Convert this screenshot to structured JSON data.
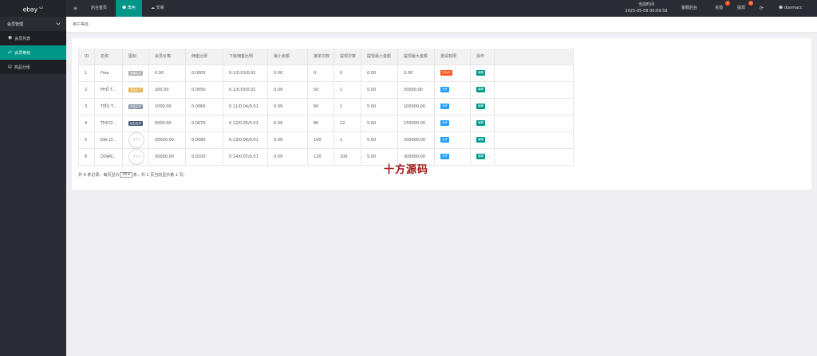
{
  "sidebar": {
    "logo": "ebay",
    "logo_sup": "V.2",
    "group_label": "会员管理",
    "items": [
      {
        "label": "会员列表",
        "icon": "user-icon"
      },
      {
        "label": "会员等级",
        "icon": "link-icon"
      },
      {
        "label": "商品分组",
        "icon": "list-icon"
      }
    ]
  },
  "topbar": {
    "menu_icon": "≡",
    "tabs": [
      {
        "label": "后台首页"
      },
      {
        "label": "角色"
      },
      {
        "label": "交易"
      }
    ],
    "time_label": "当前时间",
    "time_value": "2025-05-08 00:09:58",
    "links": [
      {
        "label": "客服后台"
      },
      {
        "label": "充值",
        "badge": "0"
      },
      {
        "label": "提现",
        "badge": "0"
      }
    ],
    "refresh_icon": "⟳",
    "username": "duomacc"
  },
  "breadcrumb": {
    "label": "用户等级"
  },
  "table": {
    "headers": [
      "ID",
      "名称",
      "图标",
      "会员价格",
      "佣金比例",
      "下级佣金比例",
      "最小余额",
      "接单次数",
      "提现次数",
      "提现最小金额",
      "提现最大金额",
      "邀请权限",
      "操作"
    ],
    "rows": [
      {
        "id": "1",
        "name": "Free",
        "icon": {
          "kind": "tag",
          "text": "普通会员",
          "color": "#b0b0b0"
        },
        "price": "0.00",
        "commission": "0.0000",
        "sub_commission": "0.1/0.03/0.01",
        "min_balance": "0.00",
        "orders": "0",
        "withdraws": "0",
        "withdraw_min": "0.00",
        "withdraw_max": "0.00",
        "invite": {
          "text": "不允许",
          "color": "red"
        },
        "action": "编辑"
      },
      {
        "id": "2",
        "name": "PHỔ T...",
        "icon": {
          "kind": "tag",
          "text": "黄金会员",
          "color": "#e8b04a"
        },
        "price": "200.00",
        "commission": "0.0050",
        "sub_commission": "0.1/0.03/0.01",
        "min_balance": "0.09",
        "orders": "50",
        "withdraws": "1",
        "withdraw_min": "5.00",
        "withdraw_max": "50000.00",
        "invite": {
          "text": "允许",
          "color": "blue"
        },
        "action": "编辑"
      },
      {
        "id": "3",
        "name": "TIỂU T...",
        "icon": {
          "kind": "tag",
          "text": "铂金会员",
          "color": "#8a94a8"
        },
        "price": "1000.00",
        "commission": "0.0060",
        "sub_commission": "0.11/0.04/0.01",
        "min_balance": "0.09",
        "orders": "60",
        "withdraws": "1",
        "withdraw_min": "5.00",
        "withdraw_max": "100000.00",
        "invite": {
          "text": "允许",
          "color": "blue"
        },
        "action": "编辑"
      },
      {
        "id": "4",
        "name": "THƯỢ...",
        "icon": {
          "kind": "tag",
          "text": "钻石会员",
          "color": "#4a5a78"
        },
        "price": "5000.00",
        "commission": "0.0070",
        "sub_commission": "0.12/0.05/0.01",
        "min_balance": "0.09",
        "orders": "80",
        "withdraws": "12",
        "withdraw_min": "5.00",
        "withdraw_max": "150000.00",
        "invite": {
          "text": "允许",
          "color": "blue"
        },
        "action": "编辑"
      },
      {
        "id": "5",
        "name": "ĐẠI LÝ...",
        "icon": {
          "kind": "stamp",
          "text": "404",
          "color": "#cccccc"
        },
        "price": "20000.00",
        "commission": "0.0080",
        "sub_commission": "0.13/0.06/0.01",
        "min_balance": "0.09",
        "orders": "100",
        "withdraws": "1",
        "withdraw_min": "5.00",
        "withdraw_max": "200000.00",
        "invite": {
          "text": "允许",
          "color": "blue"
        },
        "action": "编辑"
      },
      {
        "id": "6",
        "name": "DOAN...",
        "icon": {
          "kind": "stamp",
          "text": "404",
          "color": "#cccccc"
        },
        "price": "50000.00",
        "commission": "0.0100",
        "sub_commission": "0.14/0.07/0.01",
        "min_balance": "0.09",
        "orders": "120",
        "withdraws": "100",
        "withdraw_min": "5.00",
        "withdraw_max": "300000.00",
        "invite": {
          "text": "允许",
          "color": "blue"
        },
        "action": "编辑"
      }
    ]
  },
  "pager": {
    "before": "共 6 条记录，每页显示",
    "per_page": "20",
    "after": "条，共 1 页当前显示第 1 页。"
  },
  "watermark": "十方源码",
  "colors": {
    "accent": "#009688",
    "sidebar": "#2b2c33",
    "danger": "#ff5722",
    "info": "#1e9fff"
  }
}
